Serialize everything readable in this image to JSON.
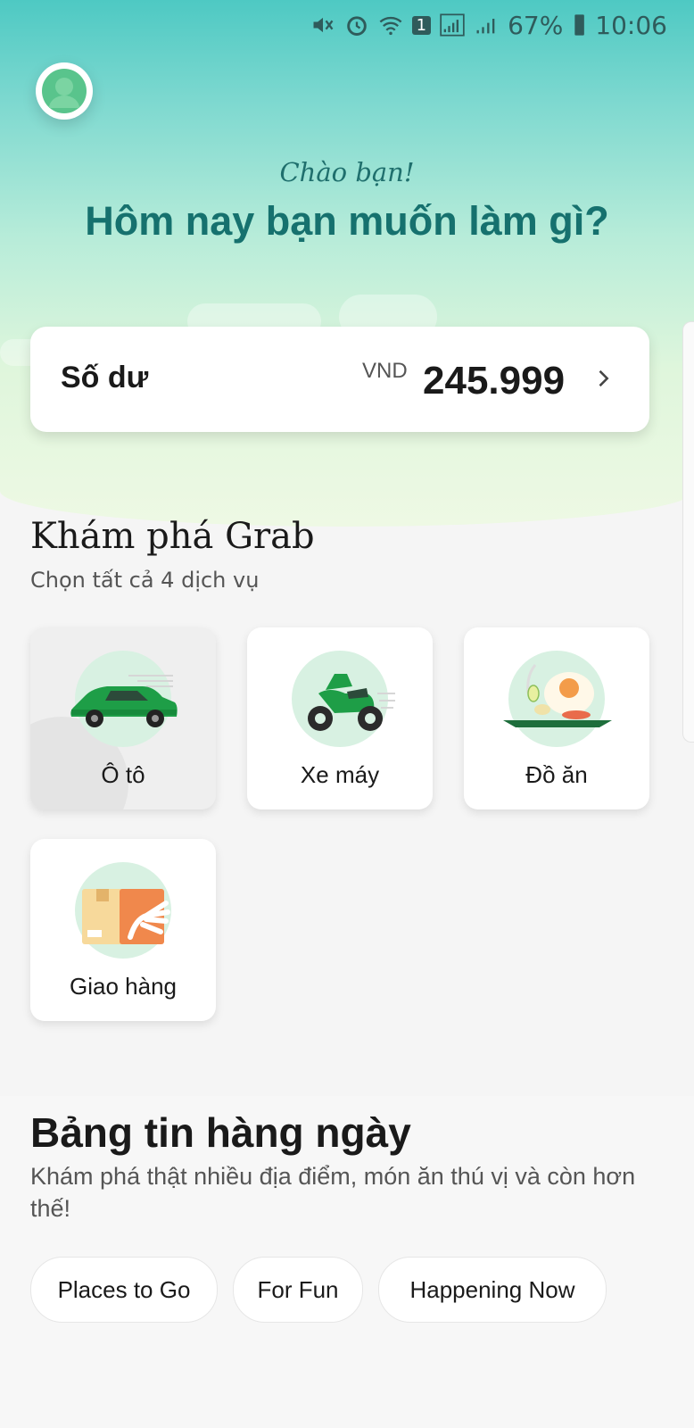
{
  "status_bar": {
    "battery": "67%",
    "time": "10:06",
    "sim_badge": "1",
    "icons": [
      "mute-icon",
      "alarm-icon",
      "wifi-icon",
      "sim-icon",
      "signal-icon",
      "signal-icon",
      "battery-icon"
    ]
  },
  "header": {
    "greeting": "Chào bạn!",
    "question": "Hôm nay bạn muốn làm gì?"
  },
  "balance": {
    "label": "Số dư",
    "currency": "VND",
    "amount": "245.999"
  },
  "explore": {
    "title": "Khám phá Grab",
    "subtitle": "Chọn tất cả 4 dịch vụ",
    "services": [
      {
        "label": "Ô tô",
        "icon": "car-icon"
      },
      {
        "label": "Xe máy",
        "icon": "motorbike-icon"
      },
      {
        "label": "Đồ ăn",
        "icon": "food-icon"
      },
      {
        "label": "Giao hàng",
        "icon": "delivery-icon"
      }
    ]
  },
  "news": {
    "title": "Bảng tin hàng ngày",
    "subtitle": "Khám phá thật nhiều địa điểm, món ăn thú vị và còn hơn thế!",
    "chips": [
      "Places to Go",
      "For Fun",
      "Happening Now"
    ]
  },
  "colors": {
    "brand_green": "#00b14f",
    "teal_heading": "#16716e",
    "sky_top": "#4ec9c3"
  }
}
